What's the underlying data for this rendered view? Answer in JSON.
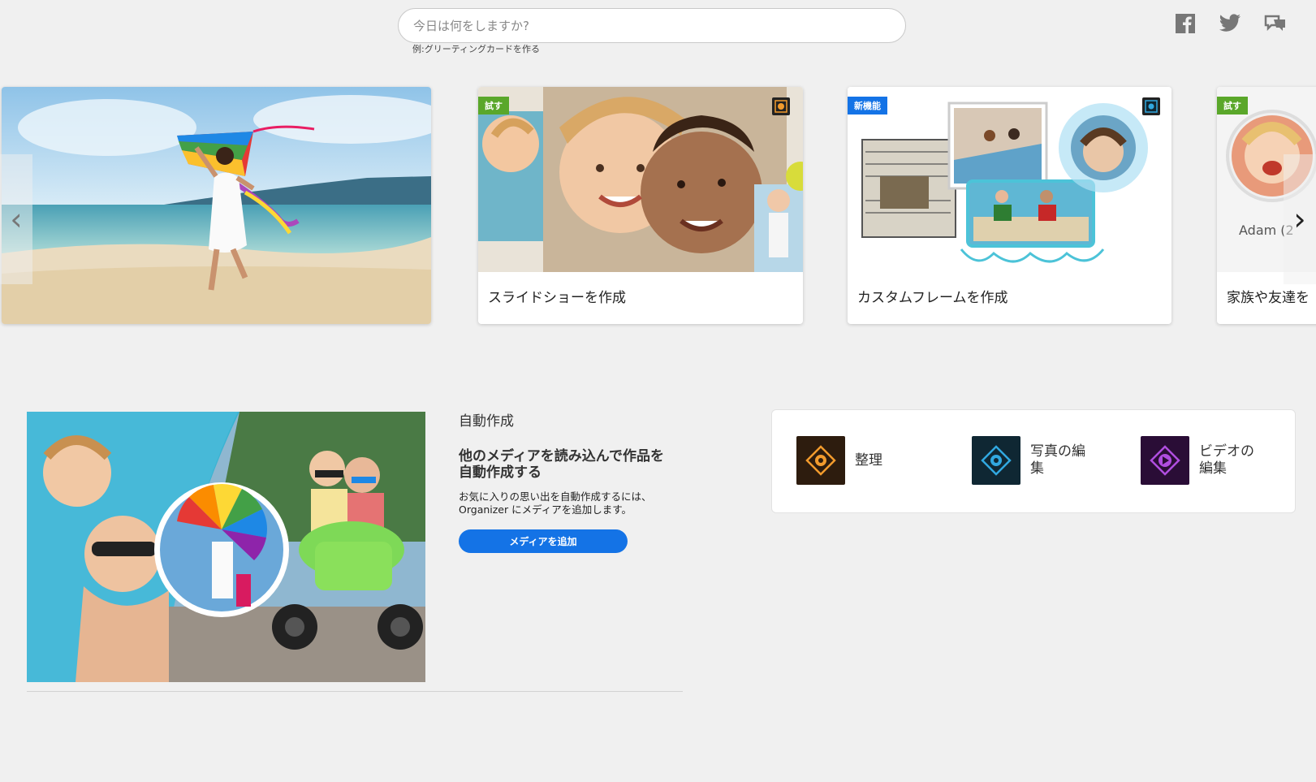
{
  "search": {
    "placeholder": "今日は何をしますか?",
    "hint": "例:グリーティングカードを作る"
  },
  "social": {
    "facebook": "facebook-icon",
    "twitter": "twitter-icon",
    "feedback": "feedback-icon"
  },
  "carousel": {
    "prev_arrow": "‹",
    "next_arrow": "›",
    "cards": [
      {
        "caption": "",
        "image": "beach-kite-photo"
      },
      {
        "caption": "スライドショーを作成",
        "badge": "試す",
        "badge_color": "#5aa72a"
      },
      {
        "caption": "カスタムフレームを作成",
        "badge": "新機能",
        "badge_color": "#1473e6"
      },
      {
        "caption": "家族や友達を",
        "badge": "試す",
        "badge_color": "#5aa72a",
        "photo_label": "Adam (2"
      }
    ]
  },
  "auto_create": {
    "label": "自動作成",
    "title": "他のメディアを読み込んで作品を自動作成する",
    "description": "お気に入りの思い出を自動作成するには、Organizer にメディアを追加します。",
    "button": "メディアを追加"
  },
  "launcher": {
    "apps": [
      {
        "label": "整理",
        "icon": "organizer-icon",
        "color": "#2d1c0e",
        "accent": "#f29b2d"
      },
      {
        "label": "写真の編集",
        "icon": "photo-editor-icon",
        "color": "#0f2733",
        "accent": "#31a8e0"
      },
      {
        "label": "ビデオの編集",
        "icon": "video-editor-icon",
        "color": "#2a0d36",
        "accent": "#b04de0"
      }
    ]
  },
  "colors": {
    "accent": "#1473e6",
    "badge_try": "#5aa72a",
    "badge_new": "#1473e6"
  }
}
